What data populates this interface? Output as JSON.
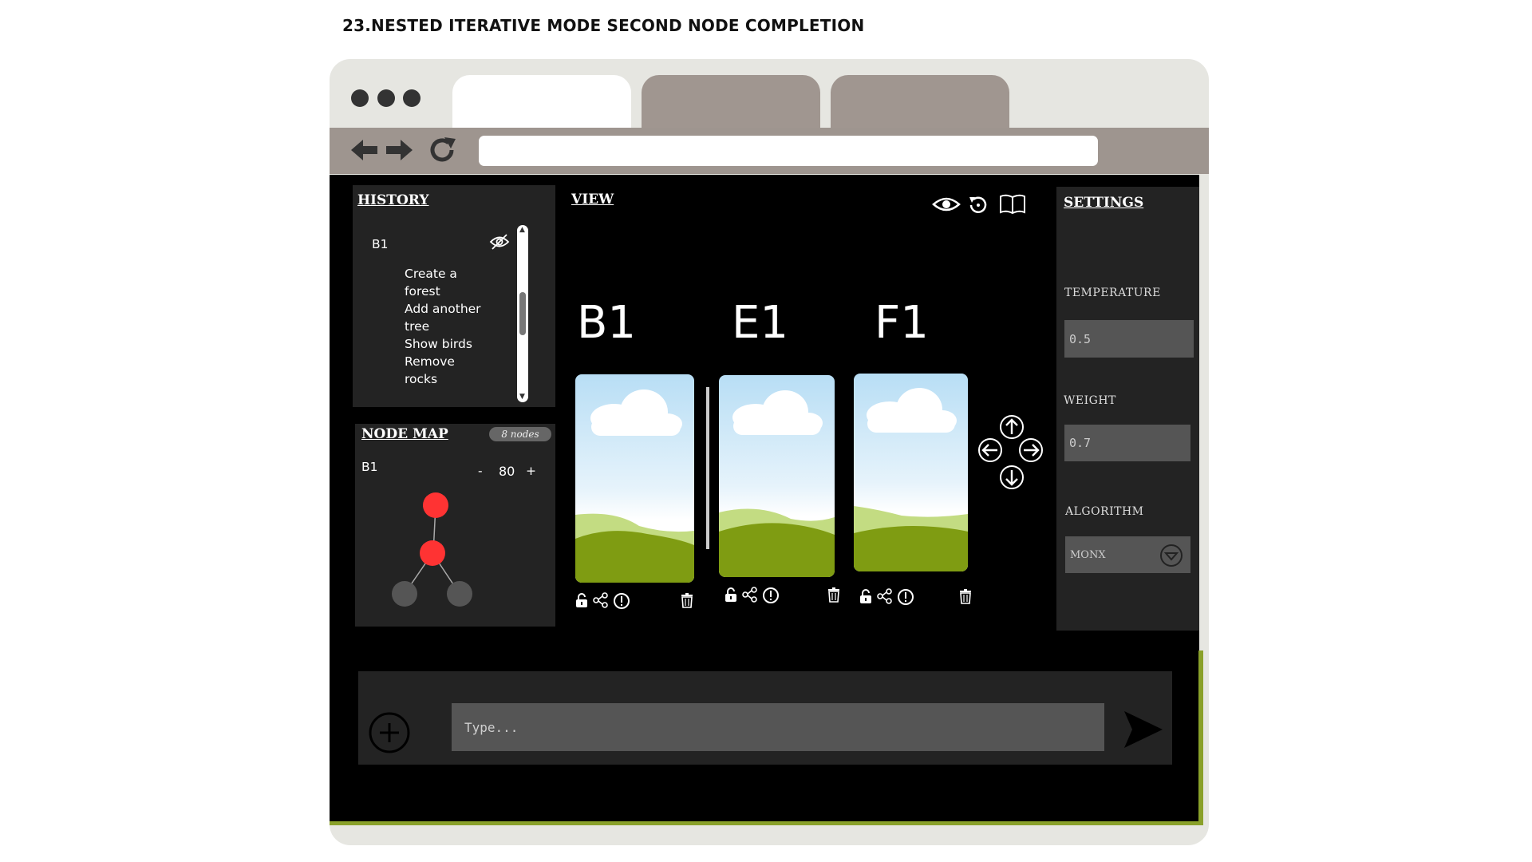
{
  "page_title": "23.NESTED ITERATIVE MODE SECOND NODE COMPLETION",
  "history": {
    "title": "HISTORY",
    "group_label": "B1",
    "items": [
      "Create a",
      "forest",
      "Add another",
      "tree",
      "Show birds",
      "Remove",
      "rocks"
    ]
  },
  "node_map": {
    "title": "NODE MAP",
    "badge": "8 nodes",
    "node_label": "B1",
    "zoom_minus": "-",
    "zoom_value": "80",
    "zoom_plus": "+"
  },
  "view": {
    "title": "VIEW",
    "nodes": [
      "B1",
      "E1",
      "F1"
    ]
  },
  "settings": {
    "title": "SETTINGS",
    "temperature_label": "TEMPERATURE",
    "temperature_value": "0.5",
    "weight_label": "WEIGHT",
    "weight_value": "0.7",
    "algorithm_label": "ALGORITHM",
    "algorithm_value": "MONX"
  },
  "chat": {
    "placeholder": "Type..."
  },
  "colors": {
    "screen_bg": "#000000",
    "panel_bg": "#232323",
    "tab_inactive": "#a09690",
    "toolbar": "#9e958f",
    "node_active": "#ff3333",
    "node_inactive": "#555555",
    "accent_green": "#8aa12a"
  },
  "icons": [
    "back-arrow-icon",
    "forward-arrow-icon",
    "reload-icon",
    "eye-icon",
    "history-icon",
    "book-icon",
    "eye-off-icon",
    "lock-icon",
    "share-icon",
    "info-icon",
    "trash-icon",
    "arrow-up-icon",
    "arrow-down-icon",
    "arrow-left-icon",
    "arrow-right-icon",
    "chevron-down-icon",
    "plus-icon",
    "send-icon"
  ]
}
